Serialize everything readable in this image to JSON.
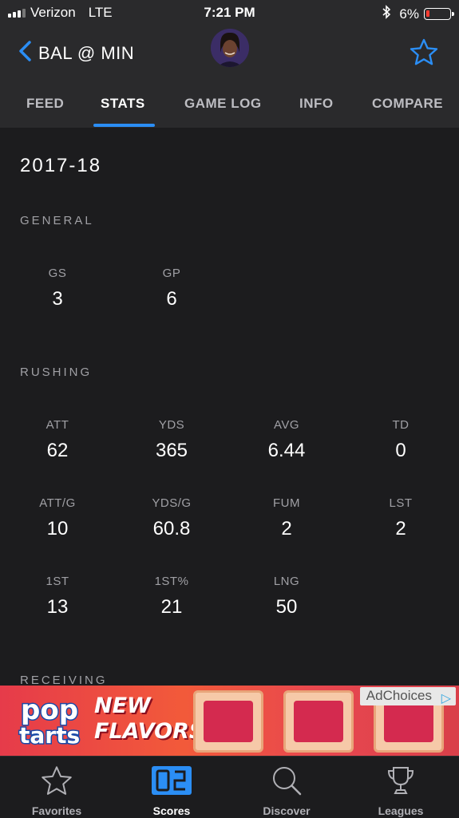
{
  "status_bar": {
    "carrier": "Verizon",
    "network": "LTE",
    "time": "7:21 PM",
    "battery": "6%"
  },
  "header": {
    "back_label": "BAL @ MIN",
    "tabs": [
      {
        "label": "FEED"
      },
      {
        "label": "STATS"
      },
      {
        "label": "GAME LOG"
      },
      {
        "label": "INFO"
      },
      {
        "label": "COMPARE"
      }
    ],
    "active_tab": "STATS",
    "accent_color": "#2b8ef5"
  },
  "stats": {
    "season": "2017-18",
    "general": {
      "title": "GENERAL",
      "items": [
        {
          "label": "GS",
          "value": "3"
        },
        {
          "label": "GP",
          "value": "6"
        }
      ]
    },
    "rushing": {
      "title": "RUSHING",
      "items": [
        {
          "label": "ATT",
          "value": "62"
        },
        {
          "label": "YDS",
          "value": "365"
        },
        {
          "label": "AVG",
          "value": "6.44"
        },
        {
          "label": "TD",
          "value": "0"
        },
        {
          "label": "ATT/G",
          "value": "10"
        },
        {
          "label": "YDS/G",
          "value": "60.8"
        },
        {
          "label": "FUM",
          "value": "2"
        },
        {
          "label": "LST",
          "value": "2"
        },
        {
          "label": "1ST",
          "value": "13"
        },
        {
          "label": "1ST%",
          "value": "21"
        },
        {
          "label": "LNG",
          "value": "50"
        }
      ]
    },
    "receiving": {
      "title": "RECEIVING"
    }
  },
  "ad": {
    "brand": "pop tarts",
    "headline_line1": "NEW",
    "headline_line2": "FLAVORS!",
    "adchoices_label": "AdChoices"
  },
  "tab_bar": {
    "items": [
      {
        "label": "Favorites",
        "icon": "star-icon"
      },
      {
        "label": "Scores",
        "icon": "scores-icon"
      },
      {
        "label": "Discover",
        "icon": "search-icon"
      },
      {
        "label": "Leagues",
        "icon": "trophy-icon"
      }
    ],
    "active": "Scores"
  }
}
